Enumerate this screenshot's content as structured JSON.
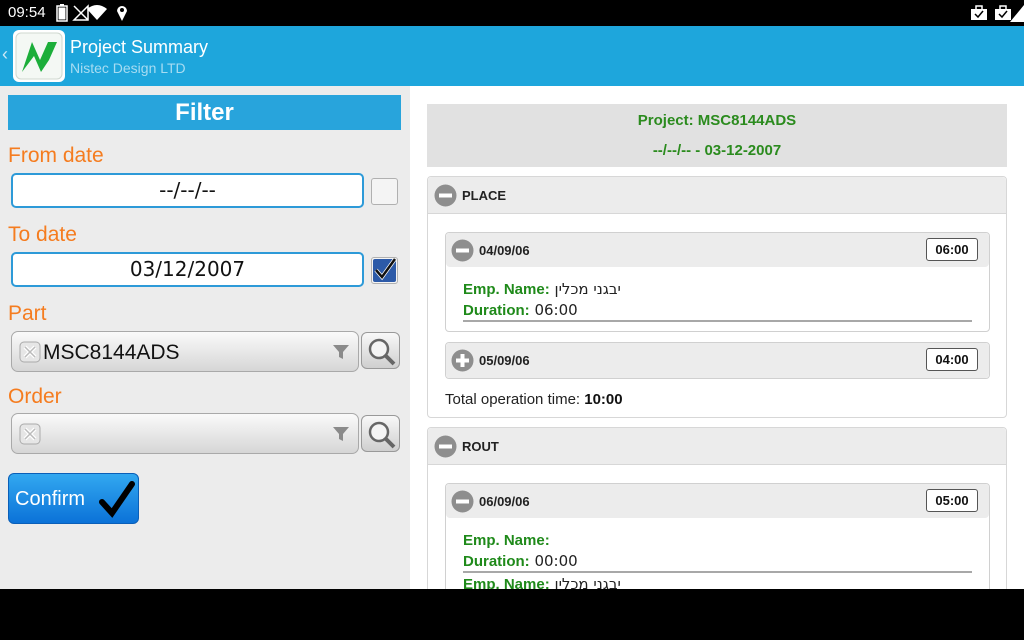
{
  "status_bar": {
    "time": "09:54",
    "left_icons": [
      "battery-icon",
      "no-signal-icon",
      "wifi-icon",
      "location-icon"
    ],
    "right_icons": [
      "briefcase-icon",
      "briefcase-icon",
      "signal-icon"
    ]
  },
  "action_bar": {
    "title": "Project Summary",
    "subtitle": "Nistec Design LTD",
    "back_glyph": "‹",
    "logo_color": "#1cae3a"
  },
  "filter": {
    "header": "Filter",
    "from_date_label": "From date",
    "from_date_value": "--/--/--",
    "from_date_checked": false,
    "to_date_label": "To date",
    "to_date_value": "03/12/2007",
    "to_date_checked": true,
    "part_label": "Part",
    "part_value": "MSC8144ADS",
    "order_label": "Order",
    "order_value": "",
    "confirm_label": "Confirm"
  },
  "summary": {
    "project_line": "Project: MSC8144ADS",
    "range_line": "--/--/-- - 03-12-2007",
    "groups": [
      {
        "title": "PLACE",
        "state": "expanded",
        "days": [
          {
            "date": "04/09/06",
            "state": "expanded",
            "time": "06:00",
            "entries": [
              {
                "name_label": "Emp. Name:",
                "name_value": "יבגני מכלין",
                "duration_label": "Duration:",
                "duration_value": "06:00"
              }
            ]
          },
          {
            "date": "05/09/06",
            "state": "collapsed",
            "time": "04:00",
            "entries": []
          }
        ],
        "total_label": "Total operation time:",
        "total_value": "10:00"
      },
      {
        "title": "ROUT",
        "state": "expanded",
        "days": [
          {
            "date": "06/09/06",
            "state": "expanded",
            "time": "05:00",
            "entries": [
              {
                "name_label": "Emp. Name:",
                "name_value": "",
                "duration_label": "Duration:",
                "duration_value": "00:00"
              },
              {
                "name_label": "Emp. Name:",
                "name_value": "יבגני מכלין",
                "duration_label": "",
                "duration_value": ""
              }
            ]
          }
        ]
      }
    ]
  },
  "colors": {
    "accent": "#1ea6dc",
    "label_orange": "#f57c1f",
    "green_text": "#2b8b1e",
    "confirm_blue": "#0b72d8"
  }
}
